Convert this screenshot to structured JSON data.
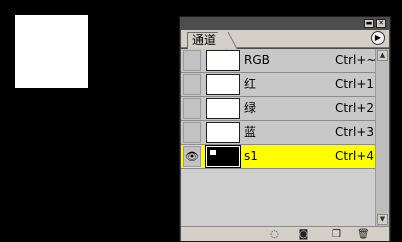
{
  "panel": {
    "tab_label": "通道",
    "menu_icon": "panel-menu-icon"
  },
  "channels": [
    {
      "name": "RGB",
      "shortcut": "Ctrl+~",
      "visible": false,
      "selected": false
    },
    {
      "name": "红",
      "shortcut": "Ctrl+1",
      "visible": false,
      "selected": false
    },
    {
      "name": "绿",
      "shortcut": "Ctrl+2",
      "visible": false,
      "selected": false
    },
    {
      "name": "蓝",
      "shortcut": "Ctrl+3",
      "visible": false,
      "selected": false
    },
    {
      "name": "s1",
      "shortcut": "Ctrl+4",
      "visible": true,
      "selected": true
    }
  ],
  "footer_icons": [
    "load-selection-icon",
    "save-selection-icon",
    "new-channel-icon",
    "delete-channel-icon"
  ],
  "colors": {
    "selected_row": "#ffff00",
    "background": "#000000"
  }
}
